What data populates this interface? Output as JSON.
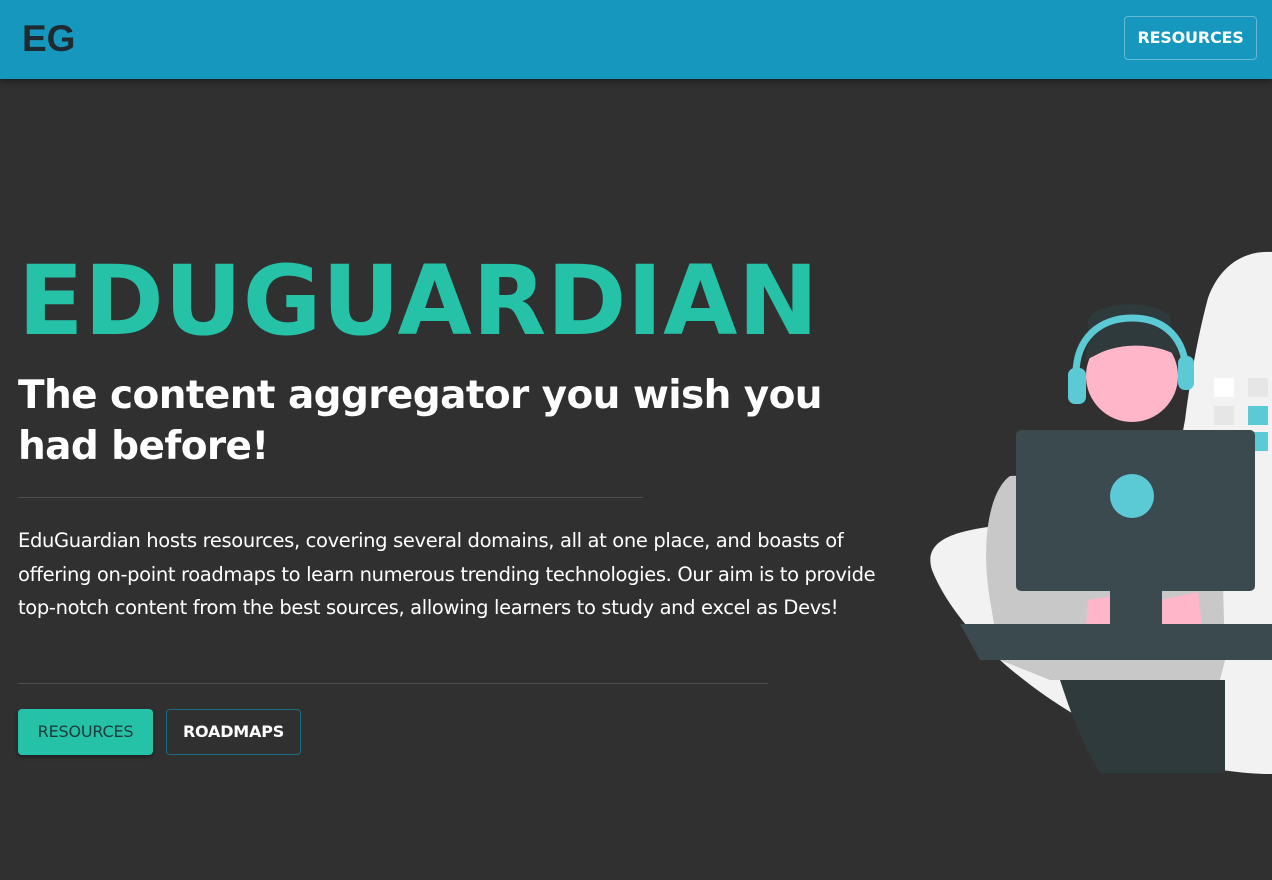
{
  "navbar": {
    "brand": "EG",
    "resources_label": "RESOURCES"
  },
  "hero": {
    "title": "EDUGUARDIAN",
    "subtitle": "The content aggregator you wish you had before!",
    "description": "EduGuardian hosts resources, covering several domains, all at one place, and boasts of offering on-point roadmaps to learn numerous trending technologies. Our aim is to provide top-notch content from the best sources, allowing learners to study and excel as Devs!",
    "buttons": {
      "resources_label": "RESOURCES",
      "roadmaps_label": "ROADMAPS"
    }
  },
  "colors": {
    "navbar": "#1597be",
    "background": "#303030",
    "accent": "#25c2a8",
    "illustration_teal": "#5ccad4",
    "illustration_pink": "#ffb6c9",
    "illustration_dark": "#3a4a4f"
  },
  "illustration": {
    "icon": "person-with-headset-at-computer-illustration"
  }
}
